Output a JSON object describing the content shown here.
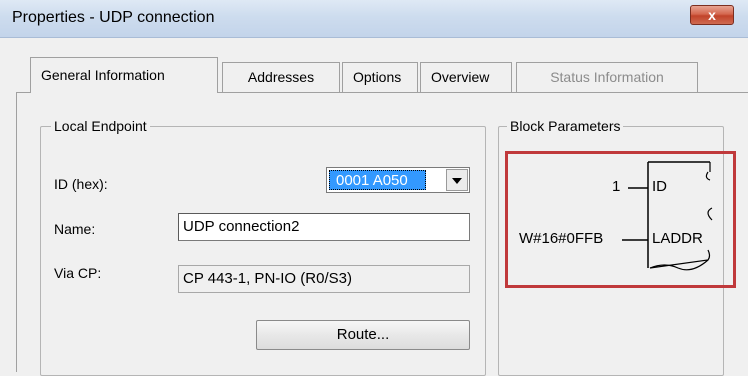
{
  "window": {
    "title": "Properties - UDP connection",
    "close_glyph": "x"
  },
  "tabs": [
    {
      "label": "General Information",
      "active": true,
      "enabled": true
    },
    {
      "label": "Addresses",
      "active": false,
      "enabled": true
    },
    {
      "label": "Options",
      "active": false,
      "enabled": true
    },
    {
      "label": "Overview",
      "active": false,
      "enabled": true
    },
    {
      "label": "Status Information",
      "active": false,
      "enabled": false
    }
  ],
  "local_endpoint": {
    "title": "Local Endpoint",
    "id_label": "ID (hex):",
    "id_value": "0001 A050",
    "name_label": "Name:",
    "name_value": "UDP connection2",
    "via_cp_label": "Via CP:",
    "via_cp_value": "CP 443-1, PN-IO (R0/S3)",
    "route_button": "Route..."
  },
  "block_parameters": {
    "title": "Block Parameters",
    "id_input_value": "1",
    "id_pin": "ID",
    "laddr_input_value": "W#16#0FFB",
    "laddr_pin": "LADDR"
  },
  "colors": {
    "highlight_border": "#c0393b",
    "selection": "#3399ff"
  }
}
